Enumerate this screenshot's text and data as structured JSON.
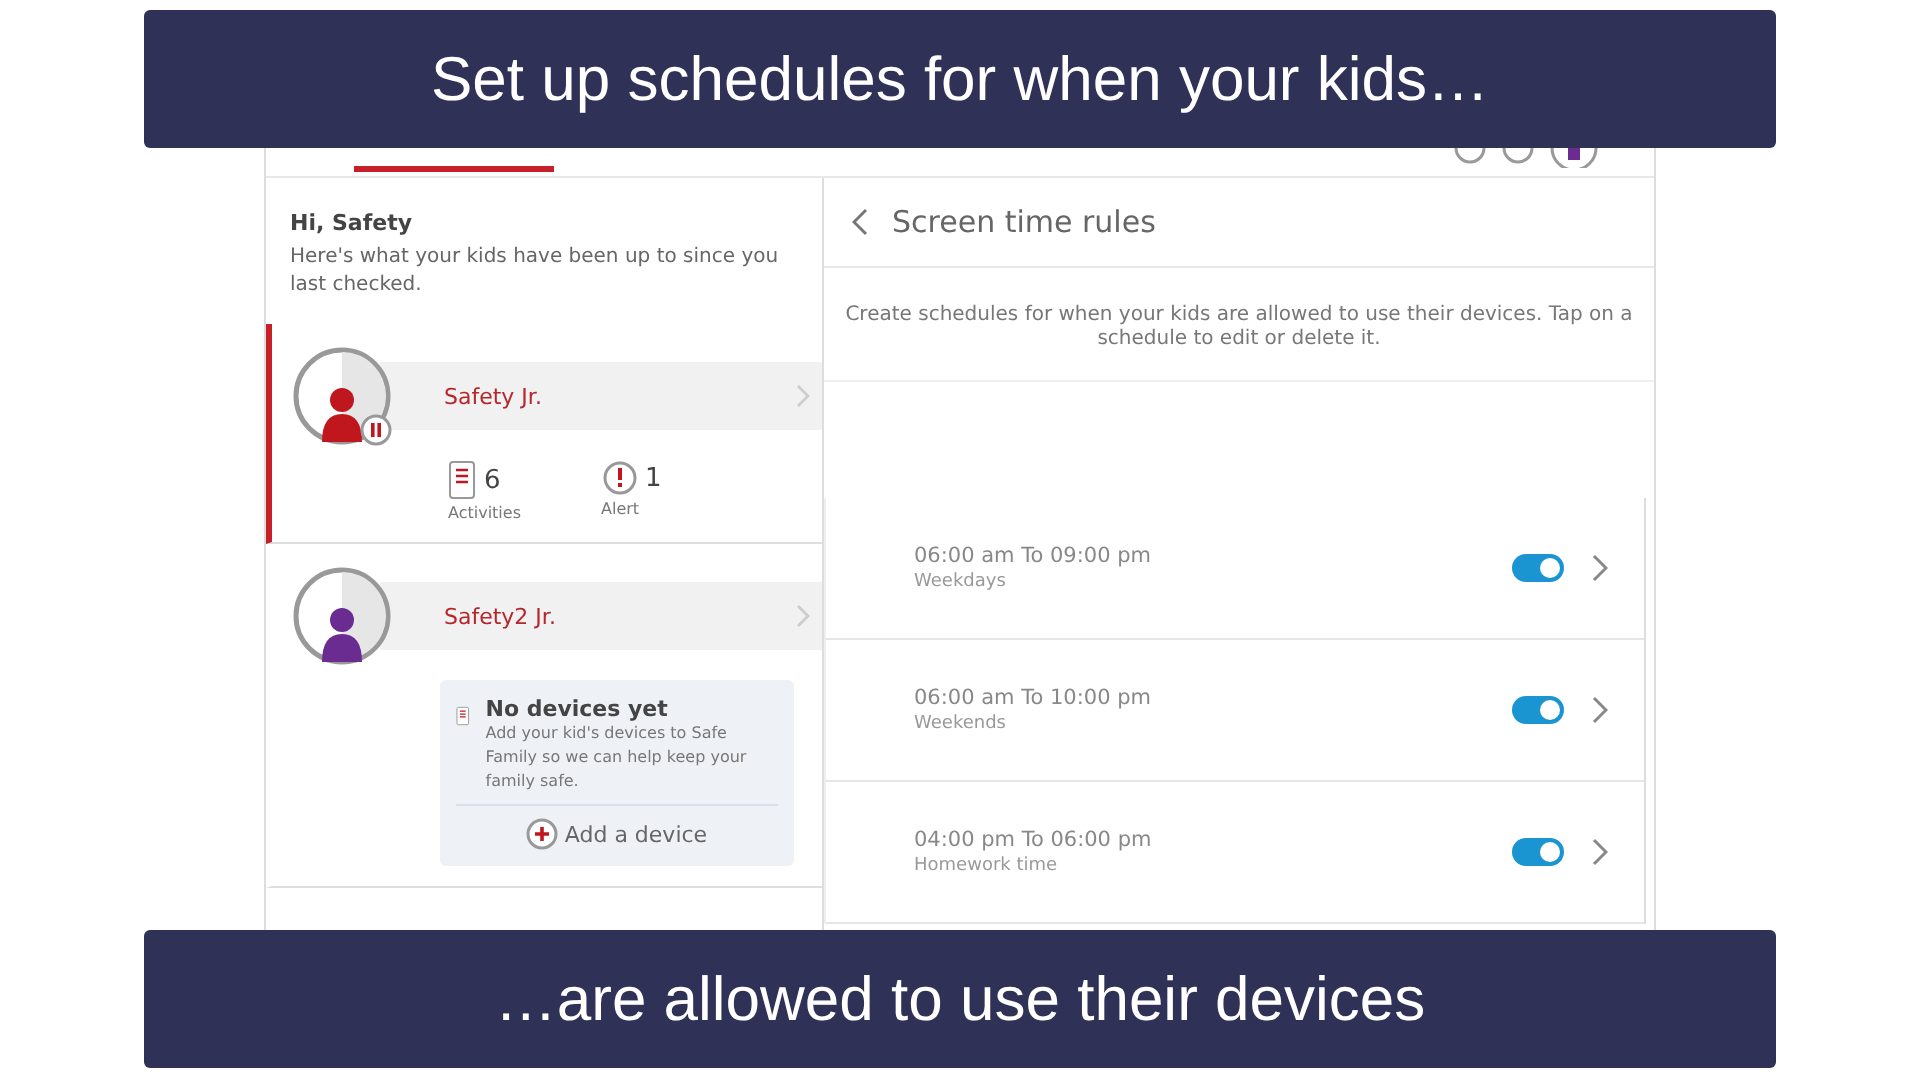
{
  "captions": {
    "top": "Set up schedules for when your kids…",
    "bottom": "…are allowed to use their devices"
  },
  "greeting": {
    "title": "Hi, Safety",
    "subtitle": "Here's what your kids have been up to since you last checked."
  },
  "kids": [
    {
      "name": "Safety Jr.",
      "selected": true,
      "color": "#c0161d",
      "paused": true,
      "kind": "stats",
      "stats": [
        {
          "kind": "activities",
          "value": "6",
          "label": "Activities"
        },
        {
          "kind": "alert",
          "value": "1",
          "label": "Alert"
        }
      ]
    },
    {
      "name": "Safety2 Jr.",
      "selected": false,
      "color": "#6b2c91",
      "paused": false,
      "kind": "empty",
      "empty": {
        "title": "No devices yet",
        "text": "Add your kid's devices to Safe Family so we can help keep your family safe.",
        "action": "Add a device"
      }
    }
  ],
  "panel": {
    "title": "Screen time rules",
    "description": "Create schedules for when your kids are allowed to use their devices. Tap on a schedule to edit or delete it."
  },
  "schedules": [
    {
      "time": "06:00 am To 09:00 pm",
      "label": "Weekdays",
      "on": true
    },
    {
      "time": "06:00 am To 10:00 pm",
      "label": "Weekends",
      "on": true
    },
    {
      "time": "04:00 pm To 06:00 pm",
      "label": "Homework time",
      "on": true
    }
  ]
}
